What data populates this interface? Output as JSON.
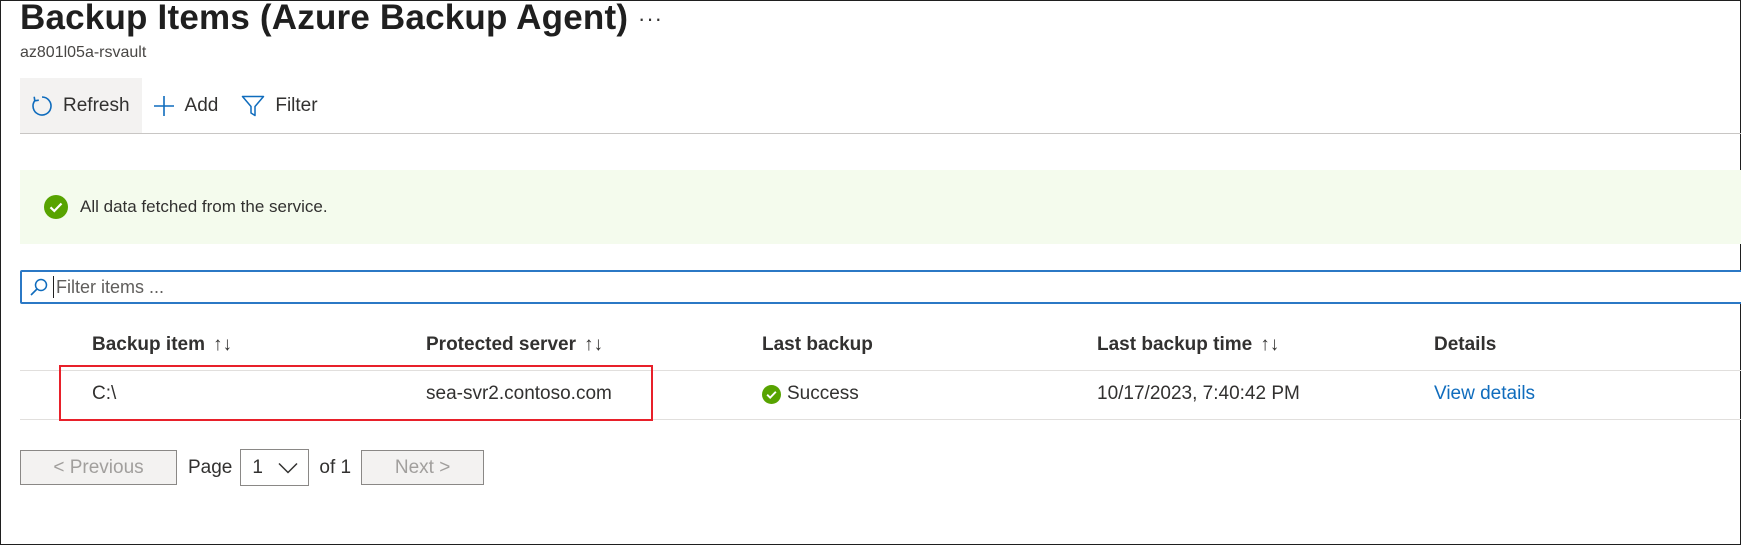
{
  "header": {
    "title": "Backup Items (Azure Backup Agent)",
    "more_label": "···",
    "subtitle": "az801l05a-rsvault"
  },
  "toolbar": {
    "refresh_label": "Refresh",
    "add_label": "Add",
    "filter_label": "Filter"
  },
  "banner": {
    "message": "All data fetched from the service."
  },
  "search": {
    "placeholder": "Filter items ..."
  },
  "table": {
    "columns": [
      {
        "label": "Backup item",
        "sort": "↑↓"
      },
      {
        "label": "Protected server",
        "sort": "↑↓"
      },
      {
        "label": "Last backup",
        "sort": ""
      },
      {
        "label": "Last backup time",
        "sort": "↑↓"
      },
      {
        "label": "Details",
        "sort": ""
      }
    ],
    "rows": [
      {
        "backup_item": "C:\\",
        "protected_server": "sea-svr2.contoso.com",
        "last_backup": "Success",
        "last_backup_time": "10/17/2023, 7:40:42 PM",
        "details": "View details"
      }
    ]
  },
  "pagination": {
    "previous_label": "< Previous",
    "page_label": "Page",
    "current_page": "1",
    "of_label": "of 1",
    "next_label": "Next >"
  },
  "colors": {
    "accent": "#0f6cbd",
    "success": "#57a300",
    "highlight": "#e8202a",
    "banner_bg": "#f4fbed"
  }
}
